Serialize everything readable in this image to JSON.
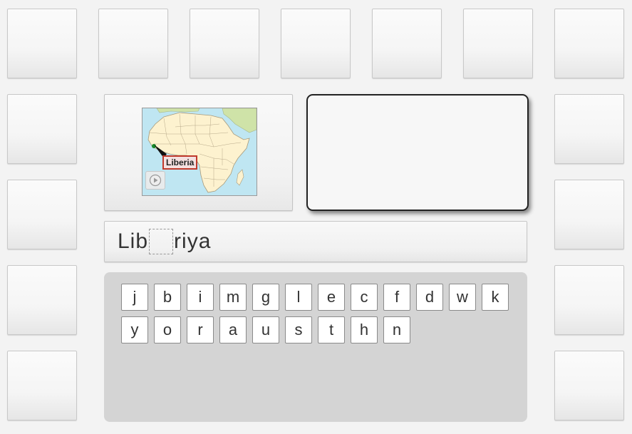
{
  "word": {
    "prefix": "Lib",
    "suffix": "riya"
  },
  "map": {
    "country_label": "Liberia",
    "audio_icon": "play-circle-icon"
  },
  "letters_row1": [
    "j",
    "b",
    "i",
    "m",
    "g",
    "l",
    "e",
    "c",
    "f",
    "d",
    "w",
    "k"
  ],
  "letters_row2": [
    "y",
    "o",
    "r",
    "a",
    "u",
    "s",
    "t",
    "h",
    "n"
  ],
  "colors": {
    "background": "#f3f3f3",
    "letter_panel": "#d4d4d4",
    "answer_border": "#222222",
    "map_land": "#fdf2cf",
    "map_water": "#bfe6f2",
    "map_highlight": "#1a8a2a",
    "label_border": "#c0392b"
  }
}
